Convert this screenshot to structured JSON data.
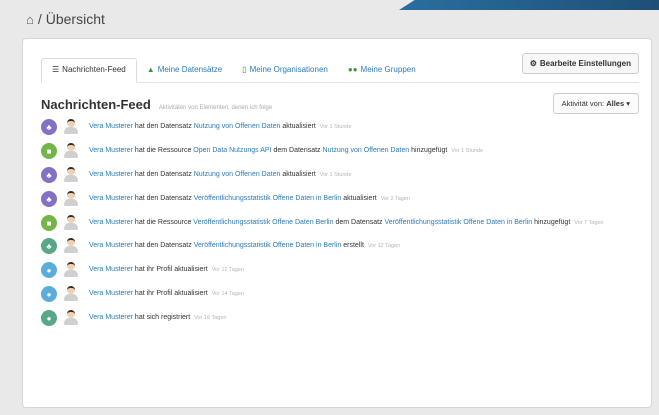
{
  "breadcrumb": {
    "home_icon": "home-icon",
    "separator": "/",
    "current": "Übersicht"
  },
  "tabs": [
    {
      "label": "Nachrichten-Feed",
      "icon": "list-icon"
    },
    {
      "label": "Meine Datensätze",
      "icon": "sitemap-icon"
    },
    {
      "label": "Meine Organisationen",
      "icon": "building-icon"
    },
    {
      "label": "Meine Gruppen",
      "icon": "group-icon"
    }
  ],
  "settings_button": {
    "label": "Bearbeite Einstellungen",
    "icon": "gear-icon"
  },
  "feed": {
    "title": "Nachrichten-Feed",
    "subtitle": "Aktivitäten von Elementen, denen ich folge",
    "filter_label": "Aktivität von:",
    "filter_value": "Alles",
    "items": [
      {
        "badge": "dataset-icon",
        "color": "#8470c4",
        "user": "Vera Musterer",
        "text1": "hat den Datensatz",
        "link1": "Nutzung von Offenen Daten",
        "text2": "aktualisiert",
        "link2": "",
        "text3": "",
        "time": "Vor 1 Stunde"
      },
      {
        "badge": "resource-icon",
        "color": "#74b54a",
        "user": "Vera Musterer",
        "text1": "hat die Ressource",
        "link1": "Open Data Nutzungs API",
        "text2": "dem Datensatz",
        "link2": "Nutzung von Offenen Daten",
        "text3": "hinzugefügt",
        "time": "Vor 1 Stunde"
      },
      {
        "badge": "dataset-icon",
        "color": "#8470c4",
        "user": "Vera Musterer",
        "text1": "hat den Datensatz",
        "link1": "Nutzung von Offenen Daten",
        "text2": "aktualisiert",
        "link2": "",
        "text3": "",
        "time": "Vor 1 Stunde"
      },
      {
        "badge": "dataset-icon",
        "color": "#8470c4",
        "user": "Vera Musterer",
        "text1": "hat den Datensatz",
        "link1": "Veröffentlichungsstatistik Offene Daten in Berlin",
        "text2": "aktualisiert",
        "link2": "",
        "text3": "",
        "time": "Vor 2 Tagen"
      },
      {
        "badge": "resource-icon",
        "color": "#74b54a",
        "user": "Vera Musterer",
        "text1": "hat die Ressource",
        "link1": "Veröffentlichungsstatistik Offene Daten Berlin",
        "text2": "dem Datensatz",
        "link2": "Veröffentlichungsstatistik Offene Daten in Berlin",
        "text3": "hinzugefügt",
        "time": "Vor 7 Tagen"
      },
      {
        "badge": "dataset-icon",
        "color": "#58a887",
        "user": "Vera Musterer",
        "text1": "hat den Datensatz",
        "link1": "Veröffentlichungsstatistik Offene Daten in Berlin",
        "text2": "erstellt",
        "link2": "",
        "text3": "",
        "time": "Vor 12 Tagen"
      },
      {
        "badge": "user-icon",
        "color": "#5aaedc",
        "user": "Vera Musterer",
        "text1": "hat ihr Profil aktualisiert",
        "link1": "",
        "text2": "",
        "link2": "",
        "text3": "",
        "time": "Vor 12 Tagen"
      },
      {
        "badge": "user-icon",
        "color": "#5aaedc",
        "user": "Vera Musterer",
        "text1": "hat ihr Profil aktualisiert",
        "link1": "",
        "text2": "",
        "link2": "",
        "text3": "",
        "time": "Vor 14 Tagen"
      },
      {
        "badge": "user-icon",
        "color": "#58a887",
        "user": "Vera Musterer",
        "text1": "hat sich registriert",
        "link1": "",
        "text2": "",
        "link2": "",
        "text3": "",
        "time": "Vor 16 Tagen"
      }
    ]
  },
  "colors": {
    "link": "#2b7bb9",
    "accent_bar": "#1d4f77",
    "background": "#e9e9e9"
  }
}
